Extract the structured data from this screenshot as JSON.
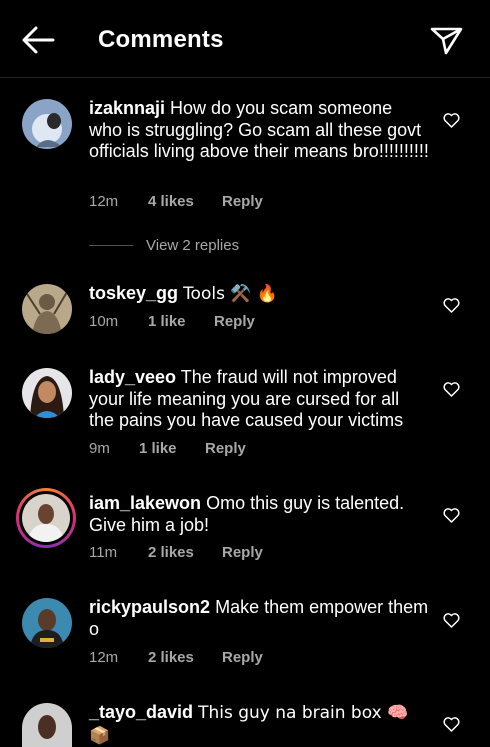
{
  "header": {
    "title": "Comments",
    "back_icon": "arrow-left-icon",
    "share_icon": "paper-plane-icon"
  },
  "colors": {
    "background": "#000000",
    "text": "#ffffff",
    "muted": "#a8a8a8",
    "ring_start": "#f58529",
    "ring_end": "#8134af"
  },
  "comments": [
    {
      "username": "izaknnaji",
      "text": "How do you scam someone who is struggling? Go scam all these govt officials living above their means bro!!!!!!!!!!",
      "time": "12m",
      "likes": "4 likes",
      "reply": "Reply",
      "view_replies": "View 2 replies"
    },
    {
      "username": "toskey_gg",
      "text": "Tools ⚒️ 🔥",
      "time": "10m",
      "likes": "1 like",
      "reply": "Reply"
    },
    {
      "username": "lady_veeo",
      "text": "The fraud will not improved your life meaning you are cursed for all the pains you have caused your victims",
      "time": "9m",
      "likes": "1 like",
      "reply": "Reply"
    },
    {
      "username": "iam_lakewon",
      "text": "Omo this guy is talented. Give him a job!",
      "time": "11m",
      "likes": "2 likes",
      "reply": "Reply"
    },
    {
      "username": "rickypaulson2",
      "text": "Make them empower them o",
      "time": "12m",
      "likes": "2 likes",
      "reply": "Reply"
    },
    {
      "username": "_tayo_david",
      "text": "This guy na brain box 🧠 📦",
      "time": "",
      "likes": "",
      "reply": ""
    }
  ]
}
